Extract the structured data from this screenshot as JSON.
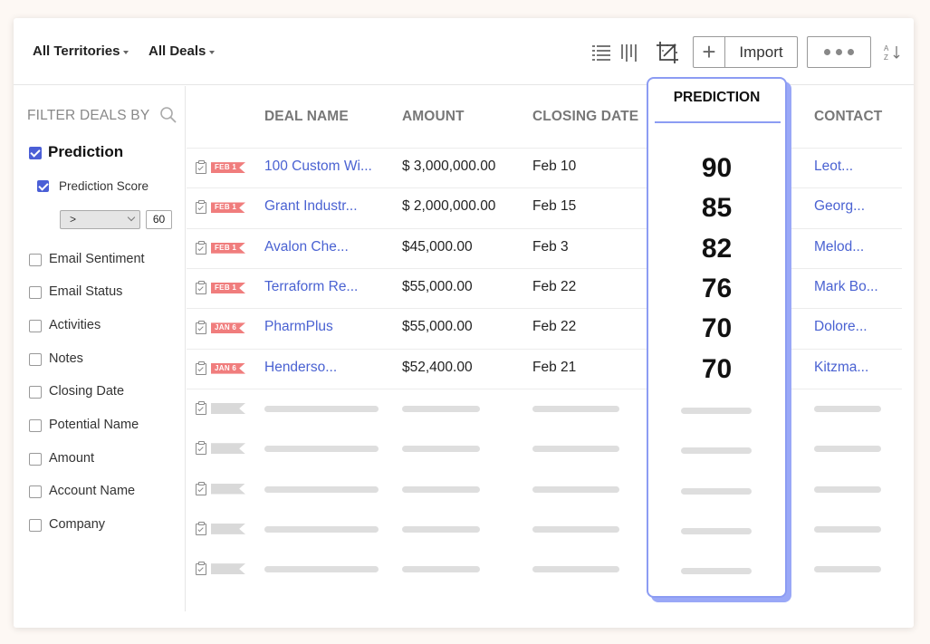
{
  "toolbar": {
    "territory_label": "All Territories",
    "deals_label": "All Deals",
    "import_label": "Import",
    "icons": [
      "list-view-icon",
      "kanban-view-icon",
      "ai-prediction-icon",
      "plus-icon",
      "more-icon",
      "sort-az-icon"
    ]
  },
  "sidebar": {
    "title": "FILTER DEALS BY",
    "prediction_label": "Prediction",
    "prediction_score_label": "Prediction Score",
    "operator": ">",
    "score_value": "60",
    "filters": [
      {
        "label": "Email Sentiment"
      },
      {
        "label": "Email Status"
      },
      {
        "label": "Activities"
      },
      {
        "label": "Notes"
      },
      {
        "label": "Closing Date"
      },
      {
        "label": "Potential Name"
      },
      {
        "label": "Amount"
      },
      {
        "label": "Account Name"
      },
      {
        "label": "Company"
      }
    ]
  },
  "table": {
    "columns": {
      "deal_name": "DEAL NAME",
      "amount": "AMOUNT",
      "closing_date": "CLOSING DATE",
      "prediction": "PREDICTION",
      "contact": "CONTACT"
    },
    "rows": [
      {
        "tag": "FEB 1",
        "deal_name": "100 Custom Wi...",
        "amount": "$ 3,000,000.00",
        "closing_date": "Feb 10",
        "prediction": "90",
        "contact": "Leot..."
      },
      {
        "tag": "FEB 1",
        "deal_name": "Grant Industr...",
        "amount": "$ 2,000,000.00",
        "closing_date": "Feb 15",
        "prediction": "85",
        "contact": "Georg..."
      },
      {
        "tag": "FEB 1",
        "deal_name": "Avalon Che...",
        "amount": "$45,000.00",
        "closing_date": "Feb 3",
        "prediction": "82",
        "contact": "Melod..."
      },
      {
        "tag": "FEB 1",
        "deal_name": "Terraform Re...",
        "amount": "$55,000.00",
        "closing_date": "Feb 22",
        "prediction": "76",
        "contact": "Mark Bo..."
      },
      {
        "tag": "JAN 6",
        "deal_name": "PharmPlus",
        "amount": "$55,000.00",
        "closing_date": "Feb 22",
        "prediction": "70",
        "contact": "Dolore..."
      },
      {
        "tag": "JAN 6",
        "deal_name": "Henderso...",
        "amount": "$52,400.00",
        "closing_date": "Feb 21",
        "prediction": "70",
        "contact": "Kitzma..."
      }
    ],
    "placeholder_row_count": 5
  },
  "colors": {
    "accent": "#4b5fd6",
    "link": "#4a62d2",
    "prediction_border": "#8c9cf3",
    "tag": "#f07d7d"
  }
}
